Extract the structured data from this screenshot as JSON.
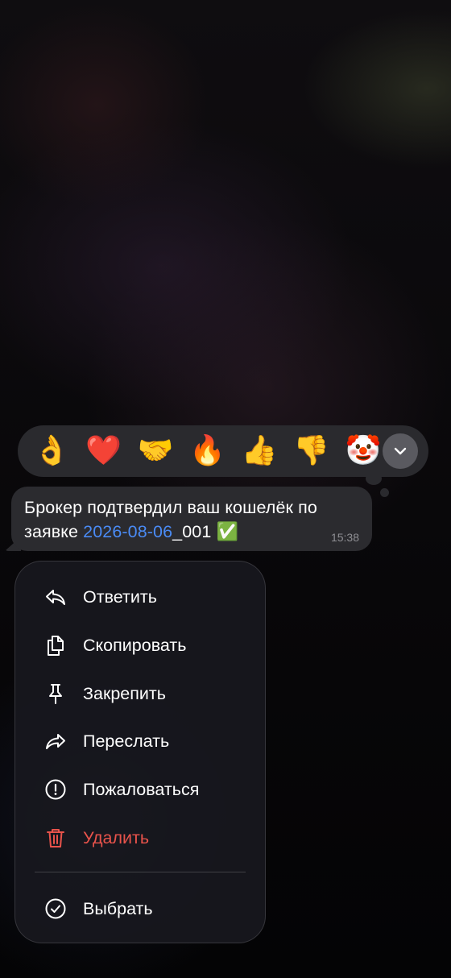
{
  "reactions": {
    "items": [
      {
        "emoji": "👌",
        "name": "ok-hand"
      },
      {
        "emoji": "❤️",
        "name": "red-heart"
      },
      {
        "emoji": "🤝",
        "name": "handshake"
      },
      {
        "emoji": "🔥",
        "name": "fire"
      },
      {
        "emoji": "👍",
        "name": "thumbs-up"
      },
      {
        "emoji": "👎",
        "name": "thumbs-down"
      },
      {
        "emoji": "🤡",
        "name": "clown-face"
      }
    ],
    "more_icon": "chevron-down-icon"
  },
  "message": {
    "text_before": "Брокер подтвердил ваш кошелёк по заявке ",
    "link_text": "2026-08-06",
    "text_after": "_001 ",
    "emoji": "✅",
    "time": "15:38",
    "link_color": "#4a8bf5"
  },
  "menu": {
    "items": [
      {
        "label": "Ответить",
        "icon": "reply-icon"
      },
      {
        "label": "Скопировать",
        "icon": "copy-icon"
      },
      {
        "label": "Закрепить",
        "icon": "pin-icon"
      },
      {
        "label": "Переслать",
        "icon": "forward-icon"
      },
      {
        "label": "Пожаловаться",
        "icon": "report-icon"
      },
      {
        "label": "Удалить",
        "icon": "trash-icon",
        "color": "#e8534b"
      },
      {
        "label": "Выбрать",
        "icon": "select-check-icon"
      }
    ]
  }
}
